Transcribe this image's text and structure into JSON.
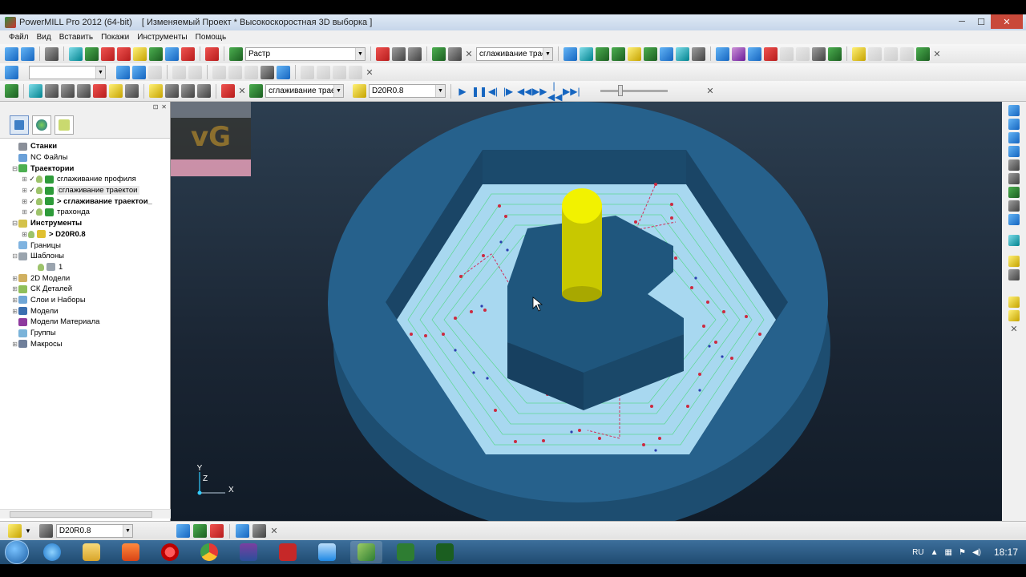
{
  "window": {
    "app_title": "PowerMILL Pro 2012 (64-bit)",
    "project_title": "[ Изменяемый Проект * Высокоскоростная 3D выборка ]",
    "minimize": "─",
    "maximize": "☐",
    "close": "✕"
  },
  "menu": [
    "Файл",
    "Вид",
    "Вставить",
    "Покажи",
    "Инструменты",
    "Помощь"
  ],
  "toolbar1": {
    "raster_label": "Растр",
    "toolpath_combo": "сглаживание траек"
  },
  "toolbar3": {
    "toolpath_combo": "сглаживание траект",
    "tool_combo": "D20R0.8"
  },
  "explorer": {
    "tree": [
      {
        "label": "Станки",
        "bold": true,
        "indent": 0,
        "exp": "",
        "icon": "machine"
      },
      {
        "label": "NC Файлы",
        "indent": 0,
        "exp": "",
        "icon": "nc"
      },
      {
        "label": "Траектории",
        "bold": true,
        "indent": 0,
        "exp": "⊟",
        "icon": "toolpaths"
      },
      {
        "label": "сглаживание профиля",
        "indent": 1,
        "exp": "⊞",
        "icon": "tp",
        "check": "✓",
        "bulb": true
      },
      {
        "label": "сглаживание траектои",
        "indent": 1,
        "exp": "⊞",
        "icon": "tp",
        "check": "✓",
        "bulb": true,
        "highlight": true
      },
      {
        "label": "> сглаживание траектои_",
        "indent": 1,
        "exp": "⊞",
        "icon": "tp",
        "check": "✓",
        "bulb": true,
        "bold": true
      },
      {
        "label": "трахонда",
        "indent": 1,
        "exp": "⊞",
        "icon": "tp",
        "check": "✓",
        "bulb": true
      },
      {
        "label": "Инструменты",
        "bold": true,
        "indent": 0,
        "exp": "⊟",
        "icon": "tools"
      },
      {
        "label": "> D20R0.8",
        "indent": 1,
        "exp": "⊞",
        "icon": "tool",
        "bulb": true,
        "bold": true
      },
      {
        "label": "Границы",
        "indent": 0,
        "exp": "",
        "icon": "boundary"
      },
      {
        "label": "Шаблоны",
        "indent": 0,
        "exp": "⊟",
        "icon": "patterns"
      },
      {
        "label": "1",
        "indent": 2,
        "exp": "",
        "icon": "pattern",
        "bulb": true
      },
      {
        "label": "2D Модели",
        "indent": 0,
        "exp": "⊞",
        "icon": "model2d"
      },
      {
        "label": "СК Деталей",
        "indent": 0,
        "exp": "⊞",
        "icon": "workplanes"
      },
      {
        "label": "Слои и Наборы",
        "indent": 0,
        "exp": "⊞",
        "icon": "layers"
      },
      {
        "label": "Модели",
        "indent": 0,
        "exp": "⊞",
        "icon": "models"
      },
      {
        "label": "Модели Материала",
        "indent": 0,
        "exp": "",
        "icon": "stock"
      },
      {
        "label": "Группы",
        "indent": 0,
        "exp": "",
        "icon": "groups"
      },
      {
        "label": "Макросы",
        "indent": 0,
        "exp": "⊞",
        "icon": "macros"
      }
    ]
  },
  "viewport": {
    "axis_y": "Y",
    "axis_x": "X",
    "axis_z": "Z"
  },
  "statusbar": {
    "tool_combo": "D20R0.8"
  },
  "taskbar": {
    "language": "RU",
    "time": "18:17"
  }
}
